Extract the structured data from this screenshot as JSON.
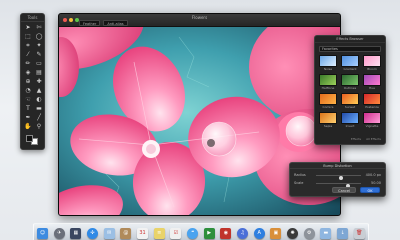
{
  "tools_palette": {
    "title": "Tools",
    "tools": [
      {
        "name": "move-tool-icon",
        "glyph": "➤"
      },
      {
        "name": "lasso-tool-icon",
        "glyph": "✄"
      },
      {
        "name": "rect-select-icon",
        "glyph": "⬚"
      },
      {
        "name": "ellipse-select-icon",
        "glyph": "◯"
      },
      {
        "name": "crop-tool-icon",
        "glyph": "⌗"
      },
      {
        "name": "magic-wand-icon",
        "glyph": "✦"
      },
      {
        "name": "eyedropper-icon",
        "glyph": "⁄"
      },
      {
        "name": "brush-icon",
        "glyph": "✎"
      },
      {
        "name": "pencil-icon",
        "glyph": "✏"
      },
      {
        "name": "eraser-icon",
        "glyph": "▭"
      },
      {
        "name": "bucket-icon",
        "glyph": "◈"
      },
      {
        "name": "gradient-icon",
        "glyph": "▤"
      },
      {
        "name": "clone-icon",
        "glyph": "⊕"
      },
      {
        "name": "heal-icon",
        "glyph": "✚"
      },
      {
        "name": "blur-icon",
        "glyph": "◔"
      },
      {
        "name": "sharpen-icon",
        "glyph": "▲"
      },
      {
        "name": "smudge-icon",
        "glyph": "☜"
      },
      {
        "name": "dodge-icon",
        "glyph": "◐"
      },
      {
        "name": "text-tool-icon",
        "glyph": "T"
      },
      {
        "name": "shape-tool-icon",
        "glyph": "▬"
      },
      {
        "name": "pen-tool-icon",
        "glyph": "✒"
      },
      {
        "name": "line-tool-icon",
        "glyph": "╱"
      },
      {
        "name": "hand-tool-icon",
        "glyph": "✋"
      },
      {
        "name": "zoom-tool-icon",
        "glyph": "⚲"
      }
    ],
    "foreground_color": "#111111",
    "background_color": "#ffffff"
  },
  "window": {
    "title": "Flowers",
    "options": [
      "Feather",
      "Anti-alias"
    ],
    "traffic_lights": [
      "#ee5a52",
      "#f3bd3d",
      "#5cc64a"
    ]
  },
  "effects_browser": {
    "title": "Effects Browser",
    "category": "Favorites",
    "effects": [
      {
        "label": "Noise",
        "colors": [
          "#6aa7e8",
          "#dff0ff"
        ]
      },
      {
        "label": "Gradient",
        "colors": [
          "#4f8fe0",
          "#a8d0ff"
        ]
      },
      {
        "label": "Bloom",
        "colors": [
          "#ff9acb",
          "#ffe0f0"
        ]
      },
      {
        "label": "Halftone",
        "colors": [
          "#3a7a2a",
          "#9bd05a"
        ]
      },
      {
        "label": "Outlines",
        "colors": [
          "#2c6a30",
          "#7cc56b"
        ]
      },
      {
        "label": "Hue",
        "colors": [
          "#a04ab8",
          "#ff7ad0"
        ]
      },
      {
        "label": "Comics",
        "colors": [
          "#e36a1c",
          "#ffb347"
        ]
      },
      {
        "label": "Sunset",
        "colors": [
          "#e85d20",
          "#ffcc55"
        ]
      },
      {
        "label": "Posterize",
        "colors": [
          "#d6282b",
          "#ff8a3c"
        ]
      },
      {
        "label": "Sepia",
        "colors": [
          "#d9731a",
          "#ffd070"
        ]
      },
      {
        "label": "Invert",
        "colors": [
          "#224aa8",
          "#6bb0ff"
        ]
      },
      {
        "label": "Vignette",
        "colors": [
          "#d02d8f",
          "#ff9fd8"
        ]
      }
    ],
    "footer": [
      "Effects",
      "All Effects"
    ]
  },
  "bump_dialog": {
    "title": "Bump Distortion",
    "radius_label": "Radius",
    "radius_value": "400.0 px",
    "radius_level": 0.55,
    "scale_label": "Scale",
    "scale_value": "50.00",
    "scale_level": 0.7,
    "cancel_label": "Cancel",
    "ok_label": "OK",
    "accent": "#2f6fd6"
  },
  "dock": {
    "items": [
      {
        "name": "finder-icon",
        "color": "#3d8be0",
        "glyph": "☺",
        "round": false
      },
      {
        "name": "launchpad-icon",
        "color": "#6a6f7a",
        "glyph": "✈",
        "round": true
      },
      {
        "name": "mission-control-icon",
        "color": "#3a4660",
        "glyph": "▦",
        "round": false
      },
      {
        "name": "safari-icon",
        "color": "#2f8ae6",
        "glyph": "✣",
        "round": true
      },
      {
        "name": "mail-icon",
        "color": "#9bbfe4",
        "glyph": "✉",
        "round": false
      },
      {
        "name": "contacts-icon",
        "color": "#b08a5a",
        "glyph": "@",
        "round": false
      },
      {
        "name": "calendar-icon",
        "color": "#f2f2f2",
        "glyph": "31",
        "round": false
      },
      {
        "name": "notes-icon",
        "color": "#e9d36a",
        "glyph": "≡",
        "round": false
      },
      {
        "name": "reminders-icon",
        "color": "#f0f0f0",
        "glyph": "☑",
        "round": false
      },
      {
        "name": "messages-icon",
        "color": "#4aa3ef",
        "glyph": "❝",
        "round": true
      },
      {
        "name": "facetime-icon",
        "color": "#2d8f3c",
        "glyph": "▶",
        "round": false
      },
      {
        "name": "photo-booth-icon",
        "color": "#c0342c",
        "glyph": "◉",
        "round": false
      },
      {
        "name": "itunes-icon",
        "color": "#4a6fd8",
        "glyph": "♫",
        "round": true
      },
      {
        "name": "app-store-icon",
        "color": "#2d7fe0",
        "glyph": "A",
        "round": true
      },
      {
        "name": "preview-icon",
        "color": "#d98f3a",
        "glyph": "▣",
        "round": false
      },
      {
        "name": "pixelmator-icon",
        "color": "#3a3a3a",
        "glyph": "✺",
        "round": true
      },
      {
        "name": "system-prefs-icon",
        "color": "#8d939b",
        "glyph": "⚙",
        "round": true
      },
      {
        "name": "folder-icon",
        "color": "#8fb6e0",
        "glyph": "▬",
        "round": false
      },
      {
        "name": "downloads-icon",
        "color": "#7ea7d4",
        "glyph": "↓",
        "round": false
      },
      {
        "name": "trash-icon",
        "color": "#c9ced4",
        "glyph": "🗑",
        "round": false
      }
    ]
  }
}
